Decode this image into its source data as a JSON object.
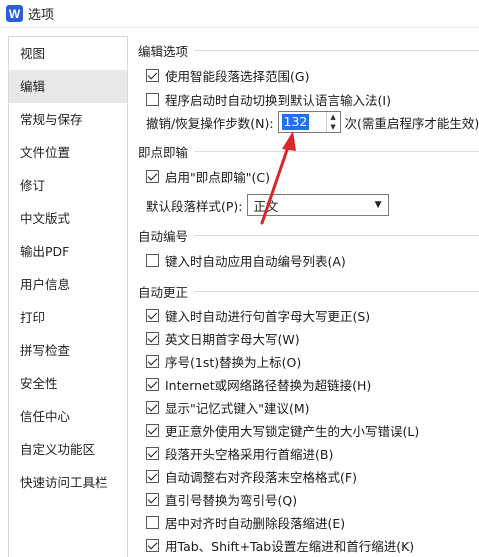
{
  "window": {
    "title": "选项",
    "logo_letter": "W"
  },
  "sidebar": {
    "items": [
      {
        "label": "视图"
      },
      {
        "label": "编辑"
      },
      {
        "label": "常规与保存"
      },
      {
        "label": "文件位置"
      },
      {
        "label": "修订"
      },
      {
        "label": "中文版式"
      },
      {
        "label": "输出PDF"
      },
      {
        "label": "用户信息"
      },
      {
        "label": "打印"
      },
      {
        "label": "拼写检查"
      },
      {
        "label": "安全性"
      },
      {
        "label": "信任中心"
      },
      {
        "label": "自定义功能区"
      },
      {
        "label": "快速访问工具栏"
      }
    ],
    "active_index": 1
  },
  "edit_options": {
    "title": "编辑选项",
    "smart_selection": {
      "label": "使用智能段落选择范围(G)",
      "checked": true
    },
    "auto_ime": {
      "label": "程序启动时自动切换到默认语言输入法(I)",
      "checked": false
    },
    "undo_label": "撤销/恢复操作步数(N):",
    "undo_value": "132",
    "undo_note": "次(需重启程序才能生效)"
  },
  "click_type": {
    "title": "即点即输",
    "enable": {
      "label": "启用\"即点即输\"(C)",
      "checked": true
    },
    "style_label": "默认段落样式(P):",
    "style_value": "正文"
  },
  "auto_number": {
    "title": "自动编号",
    "apply_list": {
      "label": "键入时自动应用自动编号列表(A)",
      "checked": false
    }
  },
  "autocorrect": {
    "title": "自动更正",
    "items": [
      {
        "label": "键入时自动进行句首字母大写更正(S)",
        "checked": true
      },
      {
        "label": "英文日期首字母大写(W)",
        "checked": true
      },
      {
        "label": "序号(1st)替换为上标(O)",
        "checked": true
      },
      {
        "label": "Internet或网络路径替换为超链接(H)",
        "checked": true
      },
      {
        "label": "显示\"记忆式键入\"建议(M)",
        "checked": true
      },
      {
        "label": "更正意外使用大写锁定键产生的大小写错误(L)",
        "checked": true
      },
      {
        "label": "段落开头空格采用行首缩进(B)",
        "checked": true
      },
      {
        "label": "自动调整右对齐段落末空格格式(F)",
        "checked": true
      },
      {
        "label": "直引号替换为弯引号(Q)",
        "checked": true
      },
      {
        "label": "居中对齐时自动删除段落缩进(E)",
        "checked": false
      },
      {
        "label": "用Tab、Shift+Tab设置左缩进和首行缩进(K)",
        "checked": true
      }
    ]
  },
  "colors": {
    "accent": "#1e73e8",
    "annotation_arrow": "#d9262b"
  }
}
